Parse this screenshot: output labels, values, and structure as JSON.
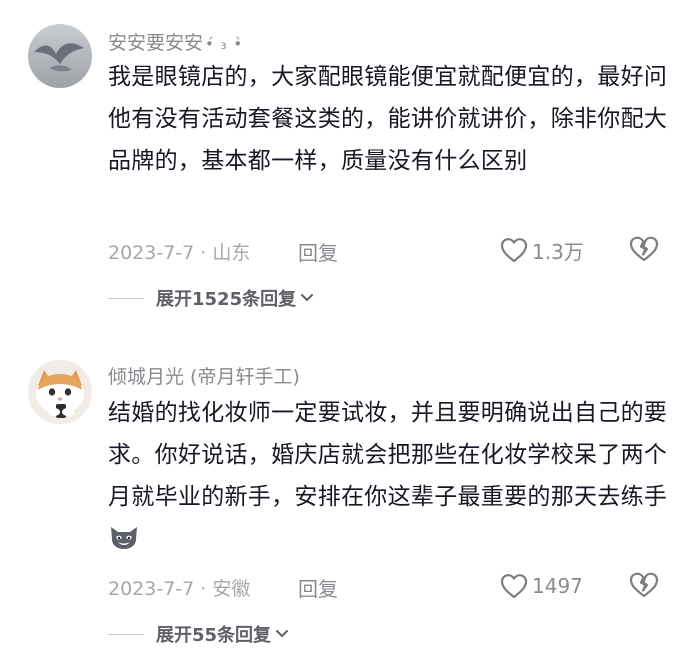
{
  "comments": [
    {
      "username": "安安要安安",
      "username_deco": "•́ ₃ •̀",
      "text": "我是眼镜店的，大家配眼镜能便宜就配便宜的，最好问他有没有活动套餐这类的，能讲价就讲价，除非你配大品牌的，基本都一样，质量没有什么区别",
      "meta": "2023-7-7 · 山东",
      "reply_label": "回复",
      "like_count": "1.3万",
      "expand_label": "展开1525条回复"
    },
    {
      "username": "倾城月光 (帝月轩手工)",
      "text": "结婚的找化妆师一定要试妆，并且要明确说出自己的要求。你好说话，婚庆店就会把那些在化妆学校呆了两个月就毕业的新手，安排在你这辈子最重要的那天去练手",
      "meta": "2023-7-7 · 安徽",
      "reply_label": "回复",
      "like_count": "1497",
      "expand_label": "展开55条回复"
    }
  ],
  "icons": {
    "like": "heart-outline-icon",
    "dislike": "broken-heart-icon",
    "expand": "chevron-down-icon",
    "emoji": "cat-emoji-icon"
  },
  "colors": {
    "text": "#161823",
    "secondary": "#8a8b91",
    "meta": "#a6a7ab"
  }
}
